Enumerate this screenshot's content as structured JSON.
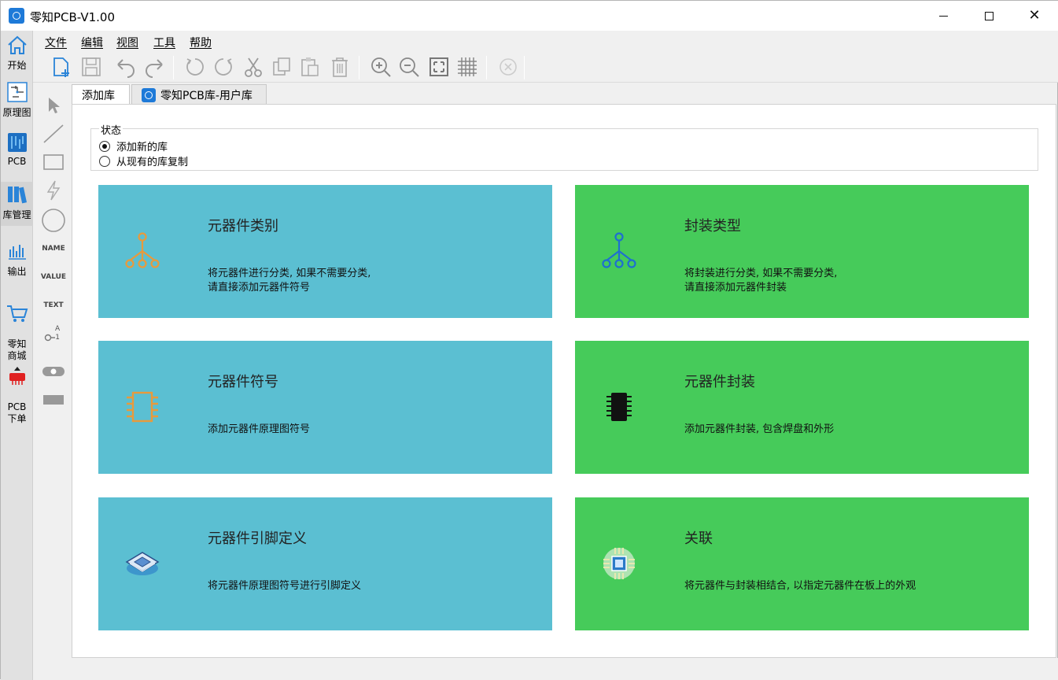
{
  "window": {
    "title": "零知PCB-V1.00"
  },
  "leftnav": {
    "items": [
      {
        "label": "开始",
        "icon": "home-icon"
      },
      {
        "label": "原理图",
        "icon": "schematic-icon"
      },
      {
        "label": "PCB",
        "icon": "pcb-icon"
      },
      {
        "label": "库管理",
        "icon": "library-icon"
      },
      {
        "label": "输出",
        "icon": "output-icon"
      },
      {
        "label": "零知\n商城",
        "icon": "cart-icon"
      },
      {
        "label": "PCB\n下单",
        "icon": "pcb-order-icon"
      }
    ]
  },
  "menu": {
    "items": [
      "文件",
      "编辑",
      "视图",
      "工具",
      "帮助"
    ]
  },
  "toolbar": {
    "buttons": [
      "new-icon",
      "save-icon",
      "undo-icon",
      "redo-icon",
      "rotate-left-icon",
      "rotate-right-icon",
      "cut-icon",
      "copy-icon",
      "paste-icon",
      "delete-icon",
      "zoom-in-icon",
      "zoom-out-icon",
      "fit-icon",
      "grid-icon",
      "stop-icon"
    ]
  },
  "drawtools": {
    "name_label": "NAME",
    "value_label": "VALUE",
    "text_label": "TEXT",
    "pin_label_top": "A",
    "pin_label_bottom": "1"
  },
  "tabs": [
    {
      "label": "添加库"
    },
    {
      "label": "零知PCB库-用户库"
    }
  ],
  "status": {
    "legend": "状态",
    "options": [
      "添加新的库",
      "从现有的库复制"
    ],
    "selected": 0
  },
  "cards": [
    {
      "title": "元器件类别",
      "desc": "将元器件进行分类, 如果不需要分类,\n请直接添加元器件符号",
      "color": "#5bbfd2",
      "icon": "category-tree-icon"
    },
    {
      "title": "封装类型",
      "desc": "将封装进行分类, 如果不需要分类,\n请直接添加元器件封装",
      "color": "#46cb5a",
      "icon": "package-tree-icon"
    },
    {
      "title": "元器件符号",
      "desc": "添加元器件原理图符号",
      "color": "#5bbfd2",
      "icon": "symbol-chip-icon"
    },
    {
      "title": "元器件封装",
      "desc": "添加元器件封装, 包含焊盘和外形",
      "color": "#46cb5a",
      "icon": "footprint-chip-icon"
    },
    {
      "title": "元器件引脚定义",
      "desc": "将元器件原理图符号进行引脚定义",
      "color": "#5bbfd2",
      "icon": "pin-define-icon"
    },
    {
      "title": "关联",
      "desc": "将元器件与封装相结合, 以指定元器件在板上的外观",
      "color": "#46cb5a",
      "icon": "link-chip-icon"
    }
  ]
}
